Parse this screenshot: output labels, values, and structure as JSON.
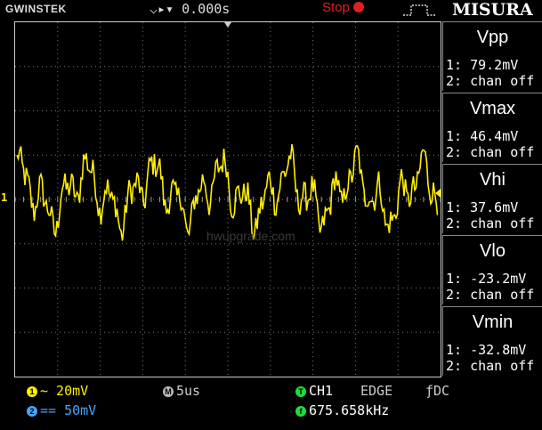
{
  "topbar": {
    "brand": "GWINSTEK",
    "trigger_delay": "0.000s",
    "run_state": "Stop",
    "menu_title": "MISURA"
  },
  "grid": {
    "channel_marker": "1",
    "watermark": "hwupgrade.com"
  },
  "measurements": [
    {
      "title": "Vpp",
      "ch1": "1: 79.2mV",
      "ch2": "2: chan off"
    },
    {
      "title": "Vmax",
      "ch1": "1: 46.4mV",
      "ch2": "2: chan off"
    },
    {
      "title": "Vhi",
      "ch1": "1: 37.6mV",
      "ch2": "2: chan off"
    },
    {
      "title": "Vlo",
      "ch1": "1: -23.2mV",
      "ch2": "2: chan off"
    },
    {
      "title": "Vmin",
      "ch1": "1: -32.8mV",
      "ch2": "2: chan off"
    }
  ],
  "bottombar": {
    "ch1_icon": "1",
    "ch1_scale": "~ 20mV",
    "ch2_icon": "2",
    "ch2_scale": "== 50mV",
    "timebase_icon": "M",
    "timebase": "5us",
    "trigger_icon": "T",
    "trigger_source": "CH1",
    "trigger_type": "EDGE",
    "coupling": "ƒDC",
    "frequency_icon": "f",
    "frequency": "675.658kHz"
  },
  "colors": {
    "ch1": "#ffee00",
    "ch2": "#44a6ff",
    "stop": "#e02020",
    "trigger": "#22dd33"
  }
}
